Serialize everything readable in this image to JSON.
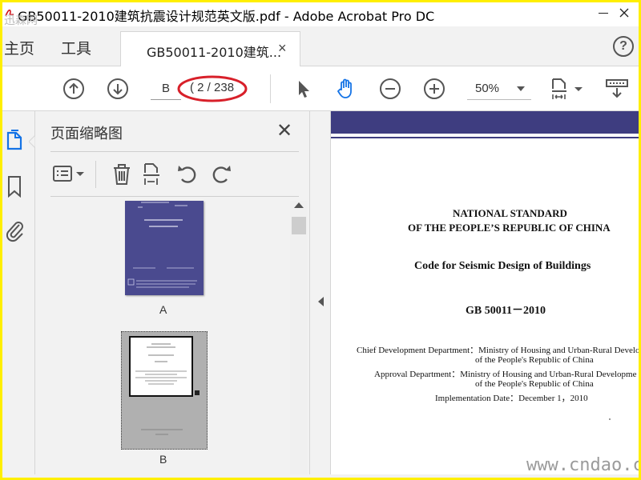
{
  "window": {
    "title": "GB50011-2010建筑抗震设计规范英文版.pdf - Adobe Acrobat Pro DC",
    "top_watermark": "迅森网"
  },
  "tabs": {
    "home": "主页",
    "tools": "工具",
    "document_tab": "GB50011-2010建筑...",
    "close_symbol": "×",
    "help_symbol": "?"
  },
  "toolbar": {
    "page_field": "B",
    "page_count": "( 2 / 238",
    "zoom": "50%",
    "icons": [
      "previous-page-icon",
      "next-page-icon",
      "select-cursor-icon",
      "hand-tool-icon",
      "zoom-out-icon",
      "zoom-in-icon",
      "fit-page-icon",
      "scroll-mode-icon"
    ],
    "annotation_color": "#d8202a"
  },
  "rail": {
    "icons": [
      "page-thumbnails-icon",
      "bookmarks-icon",
      "attachments-icon"
    ],
    "accent": "#1473e6"
  },
  "thumbnails_panel": {
    "title": "页面缩略图",
    "close_symbol": "✕",
    "tools": [
      "options-menu-icon",
      "delete-page-icon",
      "crop-page-icon",
      "rotate-counterclockwise-icon",
      "rotate-clockwise-icon"
    ],
    "pages": [
      {
        "label": "A"
      },
      {
        "label": "B",
        "selected": true
      }
    ]
  },
  "document": {
    "lines": [
      "NATIONAL STANDARD",
      "OF THE PEOPLE’S REPUBLIC OF CHINA",
      "Code for Seismic Design of Buildings",
      "GB 50011－2010",
      "Chief Development Department：Ministry of Housing and Urban-Rural Develo",
      "of the People's Republic of China",
      "Approval Department：Ministry of Housing and Urban-Rural Developme",
      "of the People's Republic of China",
      "Implementation Date：December 1，2010"
    ],
    "band_color": "#3e3d80"
  },
  "watermark": "www.cndao.com"
}
